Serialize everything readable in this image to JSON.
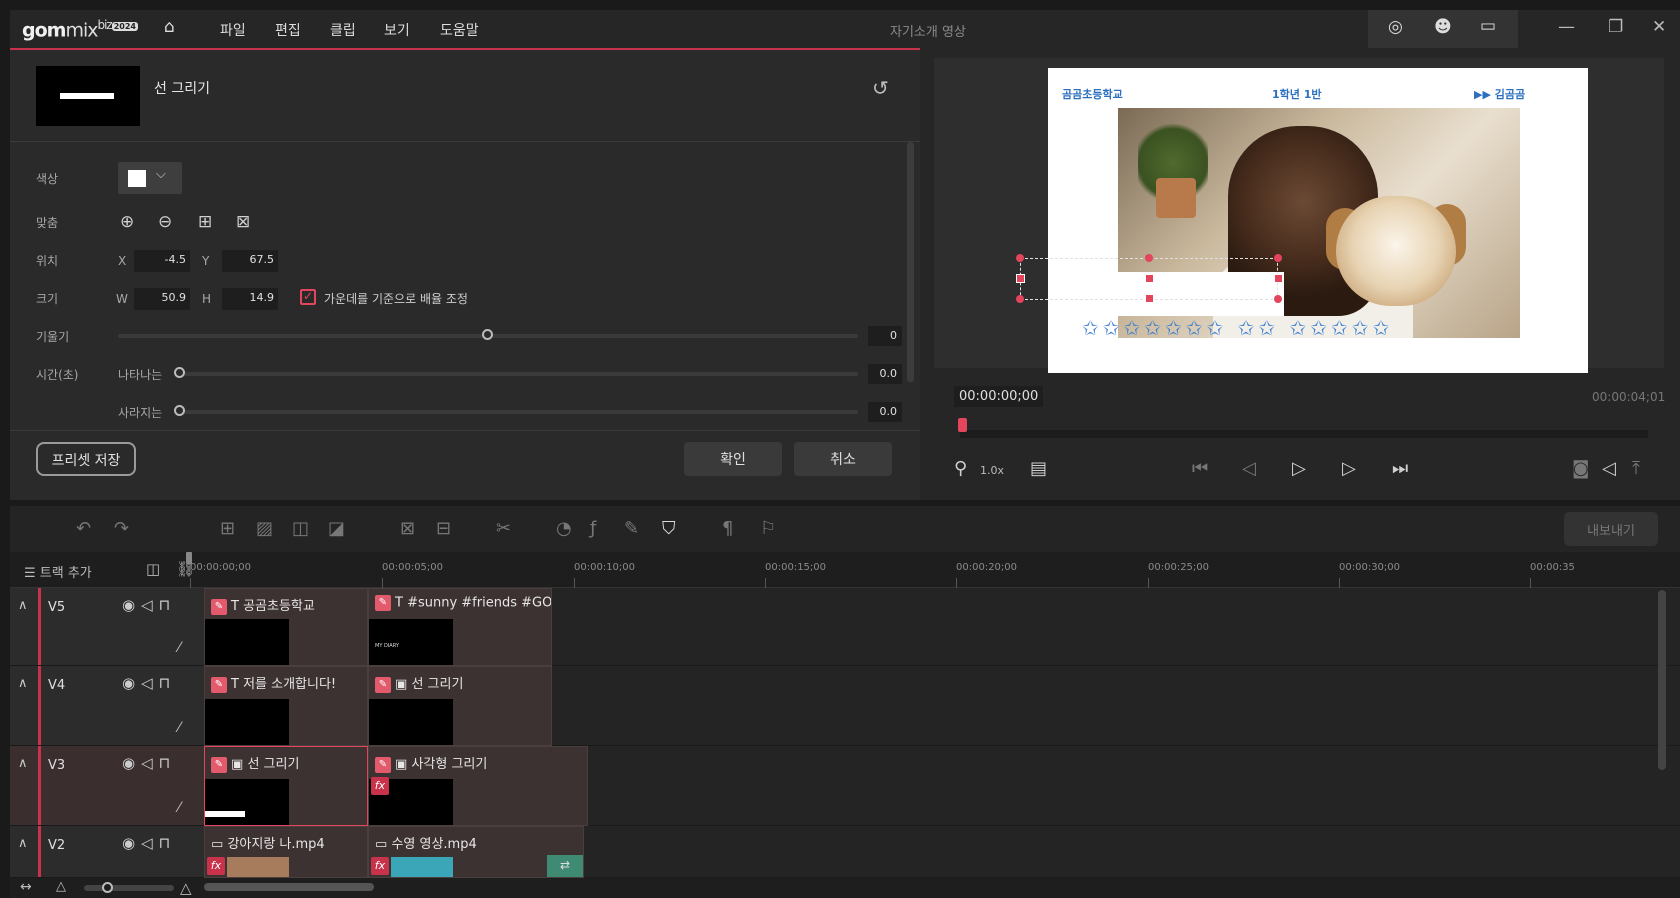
{
  "app": {
    "logo_gom": "gom",
    "logo_mix": "mix",
    "logo_biz": "biz",
    "logo_badge": "2024",
    "doc_title": "자기소개 영상",
    "menus": [
      "파일",
      "편집",
      "클립",
      "보기",
      "도움말"
    ]
  },
  "props": {
    "title": "선 그리기",
    "color_label": "색상",
    "color_value": "#ffffff",
    "align_label": "맞춤",
    "position_label": "위치",
    "x_label": "X",
    "x_value": "-4.5",
    "y_label": "Y",
    "y_value": "67.5",
    "size_label": "크기",
    "w_label": "W",
    "w_value": "50.9",
    "h_label": "H",
    "h_value": "14.9",
    "scale_center_label": "가운데를 기준으로 배율 조정",
    "scale_center_checked": true,
    "tilt_label": "기울기",
    "tilt_value": "0",
    "time_label": "시간(초)",
    "appear_label": "나타나는",
    "appear_value": "0.0",
    "disappear_label": "사라지는",
    "disappear_value": "0.0",
    "preset_button": "프리셋 저장",
    "ok_button": "확인",
    "cancel_button": "취소"
  },
  "preview": {
    "slide_school": "곰곰초등학교",
    "slide_class": "1학년 1반",
    "slide_name": "▶▶ 김곰곰",
    "current_time": "00:00:00;00",
    "total_time": "00:00:04;01",
    "zoom": "1.0x",
    "playhead_fraction": 0
  },
  "timeline": {
    "add_track": "트랙 추가",
    "export_button": "내보내기",
    "ticks": [
      "00:00:00;00",
      "00:00:05;00",
      "00:00:10;00",
      "00:00:15;00",
      "00:00:20;00",
      "00:00:25;00",
      "00:00:30;00",
      "00:00:35"
    ],
    "tracks": [
      {
        "name": "V5",
        "clips": [
          "공곰초등학교",
          "#sunny #friends #GO..."
        ]
      },
      {
        "name": "V4",
        "clips": [
          "저를 소개합니다!",
          "선 그리기"
        ]
      },
      {
        "name": "V3",
        "clips": [
          "선 그리기",
          "사각형 그리기"
        ]
      },
      {
        "name": "V2",
        "clips": [
          "강아지랑 나.mp4",
          "수영 영상.mp4"
        ]
      }
    ],
    "v5_thumb_text": "MY DIARY"
  },
  "colors": {
    "accent": "#e2455c",
    "bg": "#1a1a1a",
    "panel": "#2a2a2a"
  }
}
